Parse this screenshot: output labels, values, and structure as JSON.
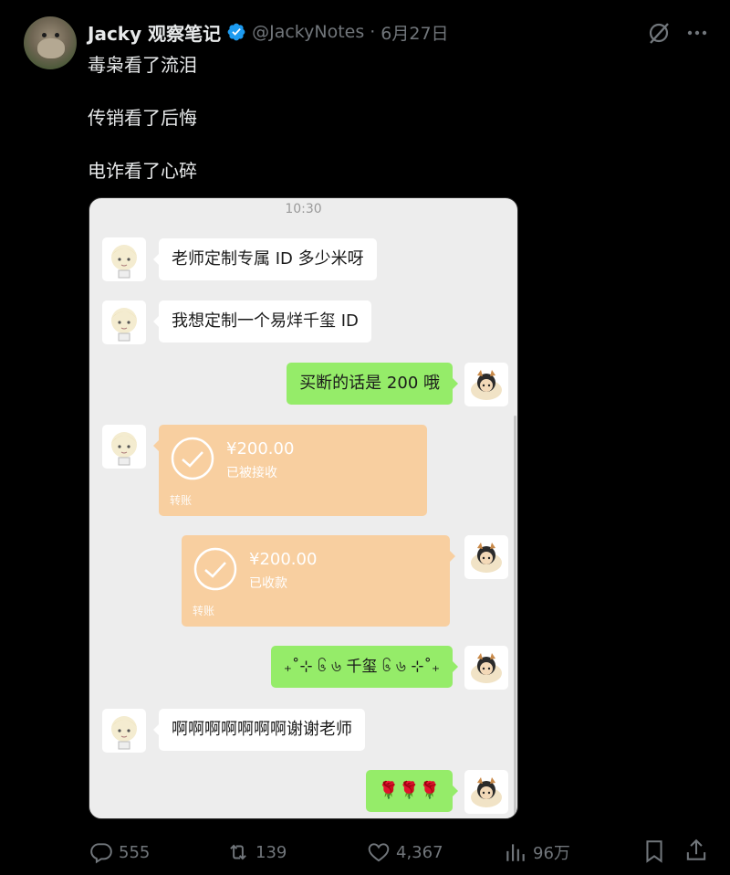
{
  "tweet": {
    "author_name": "Jacky 观察笔记",
    "handle": "@JackyNotes",
    "separator": "·",
    "date": "6月27日",
    "lines": [
      "毒枭看了流泪",
      "传销看了后悔",
      "电诈看了心碎"
    ]
  },
  "screenshot": {
    "time": "10:30",
    "messages": [
      {
        "side": "left",
        "text": "老师定制专属 ID 多少米呀"
      },
      {
        "side": "left",
        "text": "我想定制一个易烊千玺 ID"
      },
      {
        "side": "right",
        "text": "买断的话是 200 哦"
      },
      {
        "side": "left",
        "type": "transfer",
        "amount": "¥200.00",
        "status": "已被接收",
        "label": "转账"
      },
      {
        "side": "right",
        "type": "transfer",
        "amount": "¥200.00",
        "status": "已收款",
        "label": "转账"
      },
      {
        "side": "right",
        "text": "₊˚⊹ ၆ ৬ 千玺 ၆ ৬ ⊹˚₊"
      },
      {
        "side": "left",
        "text": "啊啊啊啊啊啊啊谢谢老师"
      },
      {
        "side": "right",
        "text": "🌹🌹🌹"
      }
    ]
  },
  "actions": {
    "replies": "555",
    "reposts": "139",
    "likes": "4,367",
    "views": "96万"
  },
  "icons": [
    "verified-badge-icon",
    "grok-icon",
    "more-icon",
    "reply-icon",
    "repost-icon",
    "like-icon",
    "views-icon",
    "bookmark-icon",
    "share-icon"
  ],
  "colors": {
    "verified": "#1d9bf0",
    "wechat_green": "#95ec69",
    "transfer_orange": "#f8cfa0"
  }
}
